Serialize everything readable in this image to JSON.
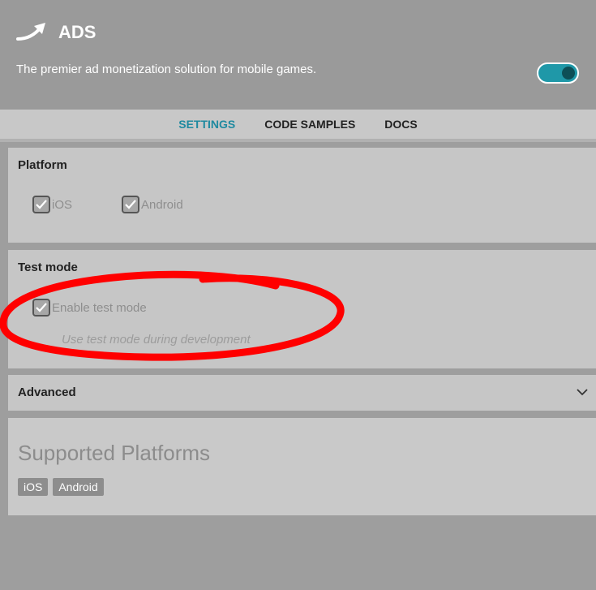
{
  "header": {
    "title": "ADS",
    "description": "The premier ad monetization solution for mobile games.",
    "toggle_on": true,
    "accent_color": "#1f98a8"
  },
  "tabs": [
    {
      "label": "SETTINGS",
      "active": true
    },
    {
      "label": "CODE SAMPLES",
      "active": false
    },
    {
      "label": "DOCS",
      "active": false
    }
  ],
  "platform": {
    "label": "Platform",
    "options": [
      {
        "label": "iOS",
        "checked": true
      },
      {
        "label": "Android",
        "checked": true
      }
    ]
  },
  "test_mode": {
    "label": "Test mode",
    "checkbox_label": "Enable test mode",
    "checked": true,
    "hint": "Use test mode during development"
  },
  "advanced": {
    "label": "Advanced",
    "expand_icon": "chevron-down-icon"
  },
  "supported_platforms": {
    "title": "Supported Platforms",
    "badges": [
      "iOS",
      "Android"
    ]
  },
  "annotation": {
    "color": "#ff0000",
    "icon": "red-circle-annotation"
  }
}
